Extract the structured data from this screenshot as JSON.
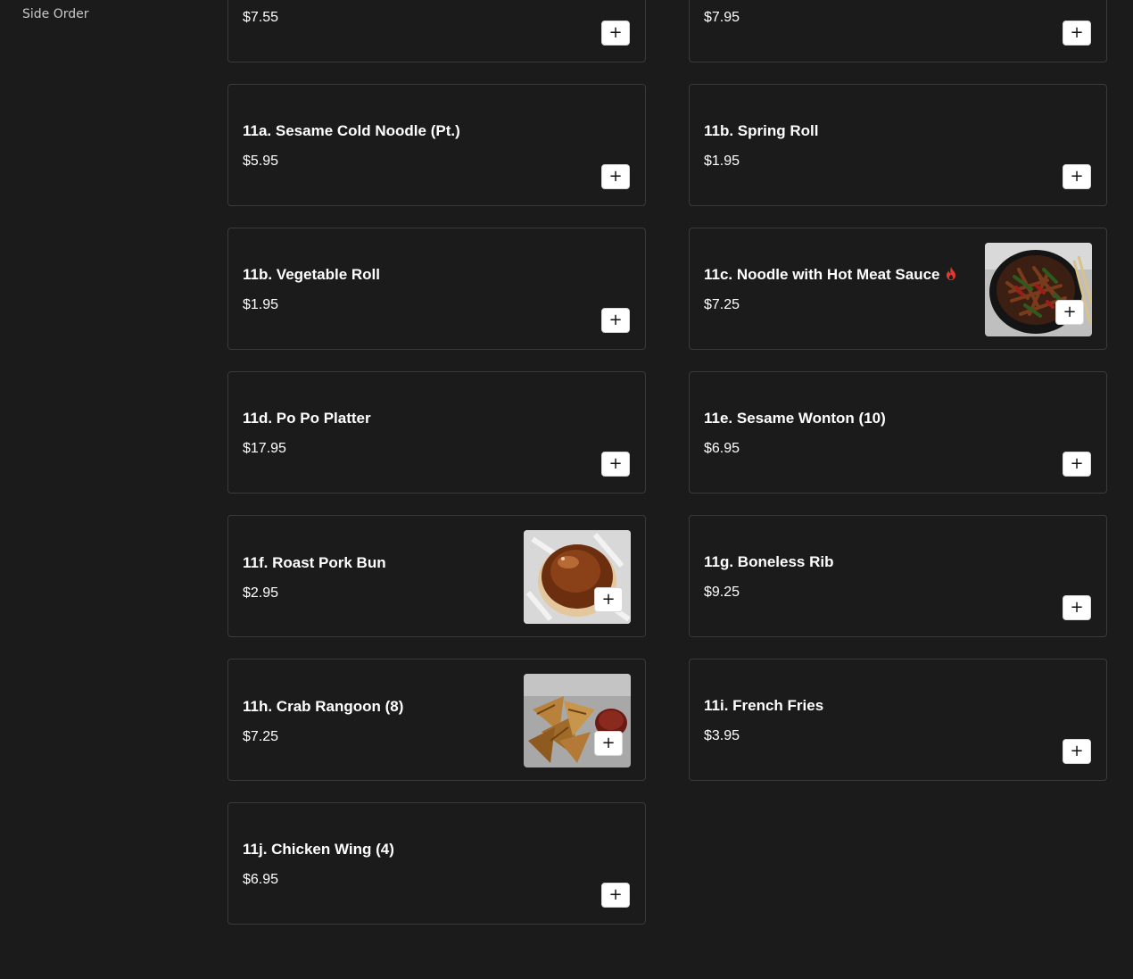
{
  "sidebar": {
    "category": "Side Order"
  },
  "items": [
    {
      "name": "",
      "price": "$7.55"
    },
    {
      "name": "",
      "price": "$7.95"
    },
    {
      "name": "11a. Sesame Cold Noodle (Pt.)",
      "price": "$5.95"
    },
    {
      "name": "11b. Spring Roll",
      "price": "$1.95"
    },
    {
      "name": "11b. Vegetable Roll",
      "price": "$1.95"
    },
    {
      "name": "11c. Noodle with Hot Meat Sauce",
      "price": "$7.25",
      "icon": "spicy-icon",
      "image": "noodle-photo"
    },
    {
      "name": "11d. Po Po Platter",
      "price": "$17.95"
    },
    {
      "name": "11e. Sesame Wonton (10)",
      "price": "$6.95"
    },
    {
      "name": "11f. Roast Pork Bun",
      "price": "$2.95",
      "image": "pork-bun-photo"
    },
    {
      "name": "11g. Boneless Rib",
      "price": "$9.25"
    },
    {
      "name": "11h. Crab Rangoon (8)",
      "price": "$7.25",
      "image": "crab-rangoon-photo"
    },
    {
      "name": "11i. French Fries",
      "price": "$3.95"
    },
    {
      "name": "11j. Chicken Wing (4)",
      "price": "$6.95"
    }
  ],
  "add_label": "+",
  "colors": {
    "background": "#1b1b1b",
    "card_border": "#3a3a3a",
    "button_bg": "#ffffff",
    "spicy": "#e03a2f"
  }
}
